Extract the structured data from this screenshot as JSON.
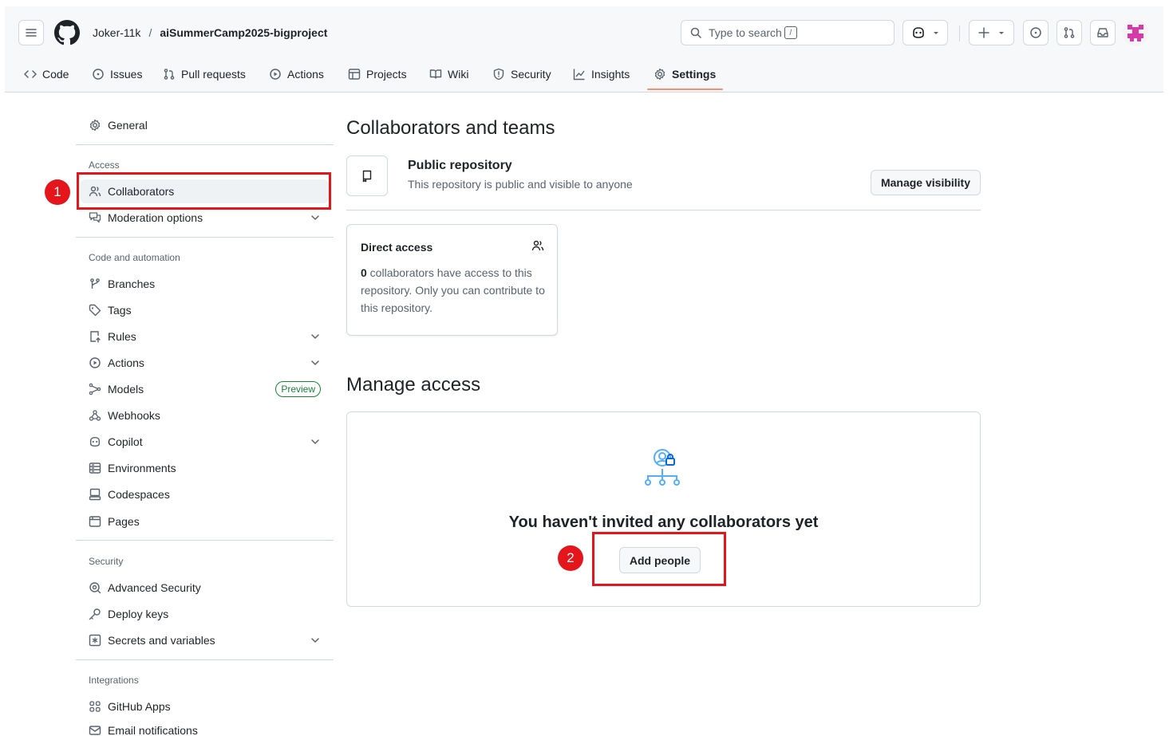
{
  "header": {
    "owner": "Joker-11k",
    "separator": "/",
    "repo": "aiSummerCamp2025-bigproject",
    "search_placeholder": "Type to search",
    "search_shortcut": "/"
  },
  "tabs": [
    {
      "label": "Code",
      "icon": "code-icon"
    },
    {
      "label": "Issues",
      "icon": "issue-opened-icon"
    },
    {
      "label": "Pull requests",
      "icon": "git-pull-request-icon"
    },
    {
      "label": "Actions",
      "icon": "play-icon"
    },
    {
      "label": "Projects",
      "icon": "table-icon"
    },
    {
      "label": "Wiki",
      "icon": "book-icon"
    },
    {
      "label": "Security",
      "icon": "shield-icon"
    },
    {
      "label": "Insights",
      "icon": "graph-icon"
    },
    {
      "label": "Settings",
      "icon": "gear-icon",
      "selected": true
    }
  ],
  "sidebar": {
    "general": "General",
    "access_heading": "Access",
    "collaborators": "Collaborators",
    "moderation": "Moderation options",
    "code_heading": "Code and automation",
    "branches": "Branches",
    "tags": "Tags",
    "rules": "Rules",
    "actions": "Actions",
    "models": "Models",
    "models_badge": "Preview",
    "webhooks": "Webhooks",
    "copilot": "Copilot",
    "environments": "Environments",
    "codespaces": "Codespaces",
    "pages": "Pages",
    "security_heading": "Security",
    "advanced_security": "Advanced Security",
    "deploy_keys": "Deploy keys",
    "secrets": "Secrets and variables",
    "integrations_heading": "Integrations",
    "github_apps": "GitHub Apps",
    "email_notifications": "Email notifications"
  },
  "main": {
    "title": "Collaborators and teams",
    "visibility_title": "Public repository",
    "visibility_desc": "This repository is public and visible to anyone",
    "manage_visibility": "Manage visibility",
    "direct_access_title": "Direct access",
    "direct_access_count": "0",
    "direct_access_text": " collaborators have access to this repository. Only you can contribute to this repository.",
    "manage_access_title": "Manage access",
    "empty_title": "You haven't invited any collaborators yet",
    "add_people": "Add people"
  },
  "annotations": {
    "step1": "1",
    "step2": "2"
  },
  "colors": {
    "highlight": "#e5161b",
    "tab_underline": "#fd8c73",
    "preview_badge": "#1a7f37",
    "empty_icon": "#54aeff"
  }
}
